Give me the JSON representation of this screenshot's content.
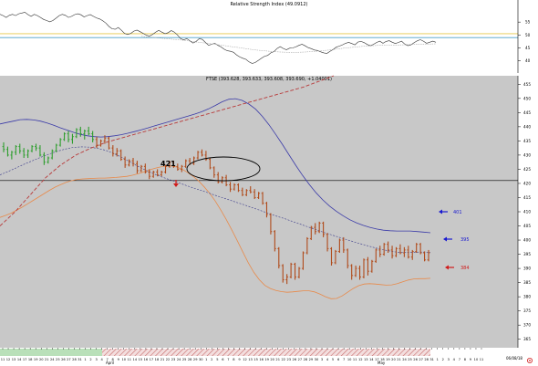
{
  "rsi_panel": {
    "title": "Relative Strength Index (49.0912)",
    "y_ticks": [
      "55",
      "50",
      "45",
      "40"
    ],
    "ylim": [
      36,
      60
    ],
    "levels": [
      50.5,
      49.0
    ]
  },
  "price_panel": {
    "title": "FTSE (393.628, 393.633, 393.608, 393.690, +1.04001)",
    "y_ticks": [
      "455",
      "450",
      "445",
      "440",
      "435",
      "430",
      "425",
      "420",
      "415",
      "410",
      "405",
      "400",
      "395",
      "390",
      "385",
      "380",
      "375",
      "370",
      "365"
    ],
    "ylim": [
      362,
      458
    ],
    "horizontal_line": 421,
    "annotations": {
      "level_421": "421",
      "ma_top": "401",
      "ma_mid": "395",
      "ma_bottom": "384"
    }
  },
  "x_axis": {
    "ticks": [
      "11",
      "12",
      "13",
      "14",
      "17",
      "18",
      "19",
      "20",
      "21",
      "24",
      "25",
      "26",
      "27",
      "28",
      "31",
      "1",
      "2",
      "3",
      "4",
      "7",
      "8",
      "9",
      "10",
      "11",
      "14",
      "15",
      "16",
      "17",
      "18",
      "21",
      "22",
      "23",
      "24",
      "25",
      "28",
      "29",
      "30",
      "1",
      "2",
      "5",
      "6",
      "7",
      "8",
      "9",
      "12",
      "13",
      "15",
      "16",
      "19",
      "20",
      "21",
      "22",
      "23",
      "26",
      "27",
      "28",
      "29",
      "30",
      "3",
      "4",
      "5",
      "6",
      "7",
      "10",
      "11",
      "12",
      "13",
      "14",
      "17",
      "18",
      "19",
      "20",
      "21",
      "24",
      "25",
      "26",
      "27",
      "28",
      "31",
      "1",
      "2",
      "3",
      "4",
      "7",
      "8",
      "9",
      "10",
      "11"
    ],
    "month_labels": [
      "April",
      "May"
    ],
    "far_right_label": "06/08/18"
  },
  "colors": {
    "panel_bg": "#c8c8c8",
    "up_bar": "#2e9e2e",
    "down_bar": "#b04a1a",
    "ma_envelope": "#3a3aa8",
    "ma_lower": "#e88a4a",
    "trendline": "#b83a3a",
    "arrow_blue": "#1a1ad0",
    "arrow_red": "#d01a1a"
  },
  "chart_data": [
    {
      "type": "line",
      "title": "Relative Strength Index (49.0912)",
      "series": [
        {
          "values": [
            58,
            57.5,
            56.8,
            57.6,
            58,
            57.5,
            58.2,
            58.5,
            58.8,
            57.9,
            57.2,
            58,
            57.5,
            56.8,
            56,
            55.6,
            55.1,
            55.6,
            56.5,
            57.5,
            58,
            57.6,
            56.8,
            57.2,
            57.9,
            58.2,
            57.8,
            57,
            57.5,
            57.9,
            57.2,
            56.6,
            56.2,
            55.5,
            54.6,
            53.3,
            52.4,
            52.2,
            52.9,
            51.8,
            50.6,
            50.2,
            50.6,
            51.5,
            51.9,
            51.3,
            50.6,
            49.9,
            49.6,
            50.2,
            51.1,
            51.8,
            51.1,
            50.5,
            50.9,
            51.7,
            51.1,
            50,
            48.6,
            48.1,
            48.6,
            47.7,
            46.9,
            47.5,
            48.6,
            48.3,
            47.1,
            46,
            46.4,
            46.8,
            46,
            45.4,
            44.5,
            43.9,
            43.7,
            43.3,
            42.3,
            41.5,
            41,
            40.6,
            39.6,
            39,
            39.4,
            40.2,
            41,
            41.8,
            42.1,
            43.1,
            43.6,
            44.8,
            45.5,
            44.8,
            44.3,
            44.9,
            45,
            45.4,
            46,
            46.4,
            45.8,
            45.1,
            44.7,
            44.2,
            44,
            43.5,
            43.1,
            42.9,
            43.7,
            44.4,
            45.3,
            45.7,
            46.2,
            46.8,
            47.1,
            46.7,
            46.2,
            47.3,
            47.5,
            47,
            46.3,
            45.8,
            46.4,
            47.1,
            47.6,
            46.8,
            47.5,
            47.8,
            47.2,
            46.7,
            47.1,
            47.6,
            46.5,
            45.9,
            46.2,
            47,
            47.7,
            48.2,
            47.6,
            46.8,
            47.2,
            47.6,
            47.2
          ]
        },
        {
          "values": [
            49.5,
            49.2,
            48.9,
            48.6,
            48.3,
            48,
            47.6,
            47.2,
            46.8,
            46.4,
            46,
            45.5,
            45.1,
            44.6,
            44.2,
            43.9,
            43.6,
            43.4,
            43.3,
            43.3,
            43.4,
            43.6,
            43.9,
            44.2,
            44.6,
            45,
            45.3,
            45.6,
            45.8,
            46,
            46.1,
            46.1,
            46.2,
            46.3,
            46.4,
            46.5,
            46.6
          ]
        }
      ]
    },
    {
      "type": "line",
      "title": "FTSE (393.628, 393.633, 393.608, 393.690, +1.04001)",
      "candles": [
        [
          433,
          434.5,
          431,
          432
        ],
        [
          432,
          433,
          429.5,
          430
        ],
        [
          430,
          431.5,
          428.5,
          431
        ],
        [
          431,
          433.5,
          430,
          433
        ],
        [
          433,
          434,
          430.5,
          431.5
        ],
        [
          431.5,
          432.5,
          429,
          430
        ],
        [
          430,
          432,
          429,
          431.5
        ],
        [
          431.5,
          433.5,
          431,
          433
        ],
        [
          433,
          434,
          431.5,
          432.5
        ],
        [
          432.5,
          433.5,
          429.5,
          430
        ],
        [
          430,
          431,
          426.5,
          427.5
        ],
        [
          427.5,
          429.5,
          427,
          429
        ],
        [
          429,
          432,
          428.5,
          431.5
        ],
        [
          431.5,
          434,
          431,
          433.5
        ],
        [
          433.5,
          436,
          433,
          435.5
        ],
        [
          435.5,
          438,
          435,
          437.5
        ],
        [
          437.5,
          438.5,
          434.5,
          435.5
        ],
        [
          435.5,
          437.5,
          434,
          436.5
        ],
        [
          436.5,
          439.5,
          436,
          439
        ],
        [
          439,
          440,
          436.5,
          437.5
        ],
        [
          437.5,
          439,
          435.5,
          438.5
        ],
        [
          438.5,
          440,
          437,
          437.5
        ],
        [
          437.5,
          438.5,
          434.5,
          435.5
        ],
        [
          435.5,
          436.5,
          432.5,
          433.5
        ],
        [
          433.5,
          435.5,
          433,
          435
        ],
        [
          435,
          437,
          434,
          436
        ],
        [
          436,
          436.5,
          432,
          432.5
        ],
        [
          432.5,
          433.5,
          429.5,
          430.5
        ],
        [
          430.5,
          432.5,
          429.5,
          431.5
        ],
        [
          431.5,
          432,
          428,
          428.5
        ],
        [
          428.5,
          429.5,
          425.5,
          426.5
        ],
        [
          426.5,
          428.5,
          426,
          428
        ],
        [
          428,
          429,
          426,
          427
        ],
        [
          427,
          428,
          423.5,
          424.5
        ],
        [
          424.5,
          426.5,
          424,
          426
        ],
        [
          426,
          427,
          423.5,
          424
        ],
        [
          424,
          425,
          421.5,
          422.5
        ],
        [
          422.5,
          424.5,
          422,
          424
        ],
        [
          424,
          425,
          422.5,
          423
        ],
        [
          423,
          424.5,
          422.5,
          424
        ],
        [
          424,
          426.5,
          423.5,
          426
        ],
        [
          426,
          428,
          425.5,
          427.5
        ],
        [
          427.5,
          428,
          425.5,
          426
        ],
        [
          426,
          427,
          424.5,
          425
        ],
        [
          425,
          426.5,
          424,
          426
        ],
        [
          426,
          428.5,
          425.5,
          428
        ],
        [
          428,
          429,
          426.5,
          427
        ],
        [
          427,
          429.5,
          426.5,
          429
        ],
        [
          429,
          431.5,
          428.5,
          431
        ],
        [
          431,
          432,
          429.5,
          430
        ],
        [
          430,
          431.5,
          428,
          428.5
        ],
        [
          428.5,
          429,
          425,
          425.5
        ],
        [
          425.5,
          426,
          422,
          423
        ],
        [
          423,
          424,
          420,
          420.5
        ],
        [
          420.5,
          422.5,
          420,
          422
        ],
        [
          422,
          423,
          419,
          419.5
        ],
        [
          419.5,
          420.5,
          417,
          418
        ],
        [
          418,
          420,
          417.5,
          419.5
        ],
        [
          419.5,
          420,
          417,
          417.5
        ],
        [
          417.5,
          418.5,
          415.5,
          416
        ],
        [
          416,
          418,
          415.5,
          417.5
        ],
        [
          417.5,
          419,
          416.5,
          417
        ],
        [
          417,
          418,
          414.5,
          415
        ],
        [
          415,
          417,
          414.5,
          416.5
        ],
        [
          416.5,
          417,
          412.5,
          413
        ],
        [
          413,
          413.5,
          408,
          409
        ],
        [
          409,
          409.5,
          402,
          403
        ],
        [
          403,
          403.5,
          396,
          397
        ],
        [
          397,
          397.5,
          390,
          391
        ],
        [
          391,
          391.5,
          385,
          386
        ],
        [
          386,
          388,
          384.5,
          387
        ],
        [
          387,
          392,
          386.5,
          391.5
        ],
        [
          391.5,
          392,
          386,
          387
        ],
        [
          387,
          390.5,
          386.5,
          390
        ],
        [
          390,
          396,
          389.5,
          395.5
        ],
        [
          395.5,
          401,
          395,
          400.5
        ],
        [
          400.5,
          405,
          400,
          404.5
        ],
        [
          404.5,
          406,
          402,
          403
        ],
        [
          403,
          406.5,
          402.5,
          406
        ],
        [
          406,
          406.5,
          401,
          402
        ],
        [
          402,
          402.5,
          396,
          397
        ],
        [
          397,
          397.5,
          391,
          392
        ],
        [
          392,
          396.5,
          391.5,
          396
        ],
        [
          396,
          400.5,
          395.5,
          400
        ],
        [
          400,
          401,
          395.5,
          396.5
        ],
        [
          396.5,
          397,
          390,
          391
        ],
        [
          391,
          391.5,
          386,
          387.5
        ],
        [
          387.5,
          391,
          387,
          390
        ],
        [
          390,
          391,
          386,
          387
        ],
        [
          387,
          393.5,
          386.5,
          393
        ],
        [
          393,
          394,
          387.5,
          389
        ],
        [
          389,
          393,
          388.5,
          392.5
        ],
        [
          392.5,
          397,
          392,
          396.5
        ],
        [
          396.5,
          398,
          394,
          395
        ],
        [
          395,
          399,
          394.5,
          398.5
        ],
        [
          398.5,
          399.5,
          395.5,
          396.5
        ],
        [
          396.5,
          398,
          393.5,
          394.5
        ],
        [
          394.5,
          397.5,
          394,
          397
        ],
        [
          397,
          398.5,
          395,
          395.5
        ],
        [
          395.5,
          397.5,
          394,
          396.5
        ],
        [
          396.5,
          398,
          393.5,
          394
        ],
        [
          394,
          396.5,
          393,
          396
        ],
        [
          396,
          399,
          395.5,
          398.5
        ],
        [
          398.5,
          399,
          395,
          395.5
        ],
        [
          395.5,
          396,
          392.5,
          393
        ],
        [
          393,
          396.5,
          392.5,
          395.5
        ]
      ],
      "series": [
        {
          "values": [
            441,
            441.5,
            442,
            442.5,
            442.6,
            442.4,
            442,
            441.3,
            440.5,
            439.6,
            438.8,
            438,
            437.3,
            436.8,
            436.5,
            436.4,
            436.5,
            436.8,
            437.2,
            437.7,
            438.3,
            438.9,
            439.6,
            440.3,
            441,
            441.7,
            442.4,
            443.1,
            443.8,
            444.5,
            445.3,
            446.3,
            447.5,
            448.8,
            449.7,
            449.9,
            449.3,
            448,
            446.2,
            443.7,
            440.7,
            437.3,
            433.7,
            430,
            426.3,
            422.8,
            419.6,
            416.7,
            414.2,
            412,
            410.2,
            408.6,
            407.2,
            406.1,
            405.2,
            404.5,
            403.9,
            403.5,
            403.3,
            403.2,
            403.2,
            403.2,
            403,
            402.8,
            402.6
          ]
        },
        {
          "values": [
            408,
            408.7,
            409.5,
            410.5,
            411.6,
            412.8,
            414,
            415.2,
            416.4,
            417.6,
            418.7,
            419.6,
            420.4,
            421,
            421.4,
            421.6,
            421.7,
            421.8,
            421.9,
            421.9,
            422,
            422.1,
            422.3,
            422.5,
            422.9,
            423.4,
            424,
            424.7,
            425.3,
            425.8,
            426.1,
            426.2,
            425.8,
            425,
            423.9,
            422.5,
            420.9,
            418.8,
            416.5,
            413.8,
            410.6,
            407.3,
            403.6,
            399.8,
            395.8,
            392,
            388.6,
            386,
            384,
            382.9,
            382.2,
            381.8,
            381.6,
            381.7,
            381.9,
            382.1,
            382.1,
            381.7,
            380.9,
            380,
            379.3,
            379.4,
            380.3,
            381.6,
            382.9,
            383.9,
            384.5,
            384.6,
            384.5,
            384.3,
            384.1,
            384.2,
            384.6,
            385.3,
            385.9,
            386.3,
            386.4,
            386.4,
            386.5
          ]
        },
        {
          "values": [
            423,
            424.2,
            425.5,
            426.8,
            428,
            429.2,
            430.3,
            431.3,
            432.1,
            432.7,
            432.9,
            432.8,
            432.4,
            431.7,
            430.6,
            429.2,
            427.6,
            426,
            424.6,
            423.3,
            422.2,
            421.2,
            420.2,
            419.2,
            418.2,
            417.3,
            416.3,
            415.3,
            414.4,
            413.4,
            412.5,
            411.5,
            410.5,
            409.5,
            408.5,
            407.6,
            406.6,
            405.6,
            404.6,
            403.6,
            402.6,
            401.7,
            400.8,
            399.9,
            399,
            398.2,
            397.4,
            396.7,
            396.1,
            395.7,
            395.6,
            395.7,
            395.8,
            395.7
          ]
        },
        {
          "values": [
            405,
            410,
            416,
            422,
            426.5,
            430,
            432.5,
            434.5,
            436,
            437.5,
            439,
            440.5,
            442,
            443.5,
            445,
            446.5,
            448,
            449.5,
            451,
            452.5,
            454,
            456,
            458
          ]
        }
      ]
    }
  ]
}
